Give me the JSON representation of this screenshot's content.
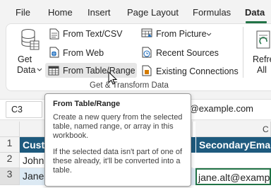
{
  "tabs": [
    "File",
    "Home",
    "Insert",
    "Page Layout",
    "Formulas",
    "Data"
  ],
  "ribbon": {
    "get_data_line1": "Get",
    "get_data_line2": "Data",
    "from_text_csv": "From Text/CSV",
    "from_web": "From Web",
    "from_table_range": "From Table/Range",
    "from_picture": "From Picture",
    "recent_sources": "Recent Sources",
    "existing_connections": "Existing Connections",
    "refresh_line1": "Refre",
    "refresh_line2": "All",
    "group_label": "Get & Transform Data"
  },
  "formula_bar": {
    "name_box": "C3",
    "formula_visible": "lt@example.com"
  },
  "grid": {
    "col_c_header": "C",
    "rows": [
      "1",
      "2",
      "3"
    ],
    "row1": {
      "a": "Custo",
      "c": "SecondaryEmail"
    },
    "row2": {
      "a": "John"
    },
    "row3": {
      "a": "Jane",
      "c": "jane.alt@examp"
    }
  },
  "tooltip": {
    "title": "From Table/Range",
    "p1": "Create a new query from the selected table, named range, or array in this workbook.",
    "p2": "If the selected data isn't part of one of these already, it'll be converted into a table."
  },
  "colors": {
    "accent": "#217346",
    "table_header": "#1e5a7e",
    "table_band": "#dce9f3"
  }
}
